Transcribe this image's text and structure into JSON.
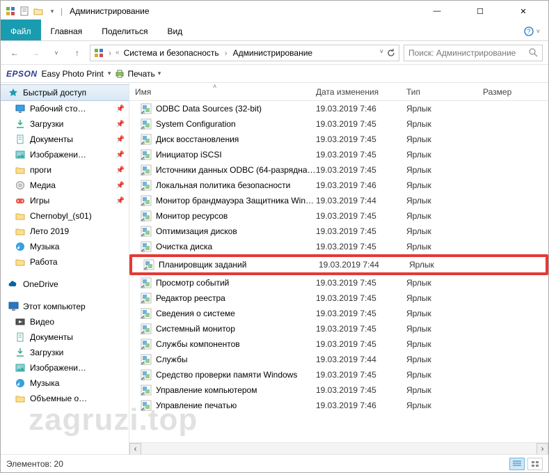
{
  "titlebar": {
    "title": "Администрирование"
  },
  "ribbon": {
    "file": "Файл",
    "home": "Главная",
    "share": "Поделиться",
    "view": "Вид"
  },
  "breadcrumb": {
    "seg1": "Система и безопасность",
    "seg2": "Администрирование"
  },
  "search": {
    "placeholder": "Поиск: Администрирование"
  },
  "epson": {
    "logo": "EPSON",
    "product": "Easy Photo Print",
    "print": "Печать"
  },
  "columns": {
    "name": "Имя",
    "date": "Дата изменения",
    "type": "Тип",
    "size": "Размер"
  },
  "sidebar": {
    "quick": "Быстрый доступ",
    "items": [
      {
        "label": "Рабочий сто…",
        "pin": true
      },
      {
        "label": "Загрузки",
        "pin": true
      },
      {
        "label": "Документы",
        "pin": true
      },
      {
        "label": "Изображени…",
        "pin": true
      },
      {
        "label": "проги",
        "pin": true
      },
      {
        "label": "Медиа",
        "pin": true
      },
      {
        "label": "Игры",
        "pin": true
      },
      {
        "label": "Chernobyl_(s01)",
        "pin": false
      },
      {
        "label": "Лето 2019",
        "pin": false
      },
      {
        "label": "Музыка",
        "pin": false
      },
      {
        "label": "Работа",
        "pin": false
      }
    ],
    "onedrive": "OneDrive",
    "thispc": "Этот компьютер",
    "pcitems": [
      {
        "label": "Видео"
      },
      {
        "label": "Документы"
      },
      {
        "label": "Загрузки"
      },
      {
        "label": "Изображени…"
      },
      {
        "label": "Музыка"
      },
      {
        "label": "Объемные о…"
      }
    ]
  },
  "files": [
    {
      "name": "ODBC Data Sources (32-bit)",
      "date": "19.03.2019 7:46",
      "type": "Ярлык"
    },
    {
      "name": "System Configuration",
      "date": "19.03.2019 7:45",
      "type": "Ярлык"
    },
    {
      "name": "Диск восстановления",
      "date": "19.03.2019 7:45",
      "type": "Ярлык"
    },
    {
      "name": "Инициатор iSCSI",
      "date": "19.03.2019 7:45",
      "type": "Ярлык"
    },
    {
      "name": "Источники данных ODBC (64-разрядна…",
      "date": "19.03.2019 7:45",
      "type": "Ярлык"
    },
    {
      "name": "Локальная политика безопасности",
      "date": "19.03.2019 7:46",
      "type": "Ярлык"
    },
    {
      "name": "Монитор брандмауэра Защитника Win…",
      "date": "19.03.2019 7:44",
      "type": "Ярлык"
    },
    {
      "name": "Монитор ресурсов",
      "date": "19.03.2019 7:45",
      "type": "Ярлык"
    },
    {
      "name": "Оптимизация дисков",
      "date": "19.03.2019 7:45",
      "type": "Ярлык"
    },
    {
      "name": "Очистка диска",
      "date": "19.03.2019 7:45",
      "type": "Ярлык"
    },
    {
      "name": "Планировщик заданий",
      "date": "19.03.2019 7:44",
      "type": "Ярлык",
      "highlight": true
    },
    {
      "name": "Просмотр событий",
      "date": "19.03.2019 7:45",
      "type": "Ярлык"
    },
    {
      "name": "Редактор реестра",
      "date": "19.03.2019 7:45",
      "type": "Ярлык"
    },
    {
      "name": "Сведения о системе",
      "date": "19.03.2019 7:45",
      "type": "Ярлык"
    },
    {
      "name": "Системный монитор",
      "date": "19.03.2019 7:45",
      "type": "Ярлык"
    },
    {
      "name": "Службы компонентов",
      "date": "19.03.2019 7:45",
      "type": "Ярлык"
    },
    {
      "name": "Службы",
      "date": "19.03.2019 7:44",
      "type": "Ярлык"
    },
    {
      "name": "Средство проверки памяти Windows",
      "date": "19.03.2019 7:45",
      "type": "Ярлык"
    },
    {
      "name": "Управление компьютером",
      "date": "19.03.2019 7:45",
      "type": "Ярлык"
    },
    {
      "name": "Управление печатью",
      "date": "19.03.2019 7:46",
      "type": "Ярлык"
    }
  ],
  "statusbar": {
    "count_label": "Элементов: 20"
  },
  "watermark": "zagruzi.top",
  "colors": {
    "accent": "#1a9cb0",
    "highlight": "#e53935"
  }
}
